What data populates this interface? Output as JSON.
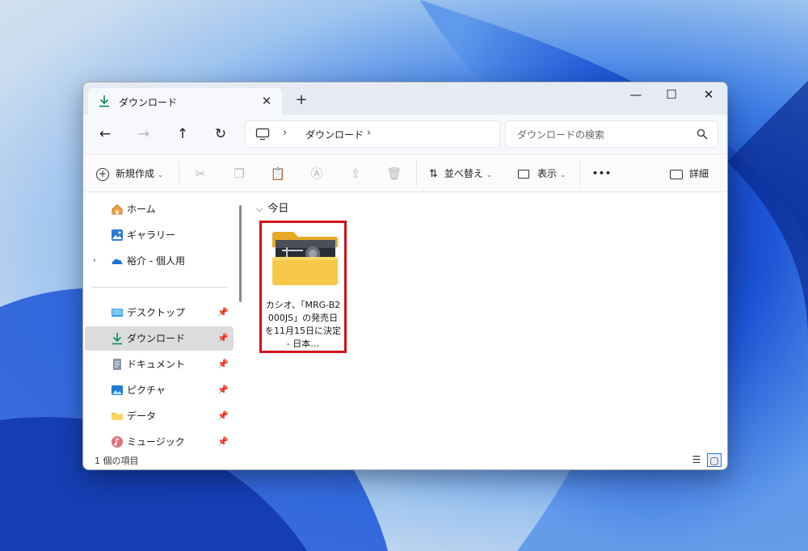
{
  "window": {
    "tab_title": "ダウンロード",
    "tab_close": "✕",
    "new_tab": "+",
    "minimize": "—",
    "maximize": "☐",
    "close": "✕"
  },
  "nav": {
    "back": "←",
    "forward": "→",
    "up": "↑",
    "refresh": "↻",
    "breadcrumb_sep": "›",
    "breadcrumb_item": "ダウンロード",
    "search_placeholder": "ダウンロードの検索"
  },
  "toolbar": {
    "new_label": "新規作成",
    "sort_label": "並べ替え",
    "view_label": "表示",
    "more_label": "•••",
    "details_label": "詳細"
  },
  "sidebar": {
    "items": [
      {
        "label": "ホーム",
        "icon": "home-icon"
      },
      {
        "label": "ギャラリー",
        "icon": "gallery-icon"
      },
      {
        "label": "裕介 - 個人用",
        "icon": "onedrive-icon"
      },
      {
        "label": "デスクトップ",
        "icon": "desktop-icon"
      },
      {
        "label": "ダウンロード",
        "icon": "download-icon"
      },
      {
        "label": "ドキュメント",
        "icon": "document-icon"
      },
      {
        "label": "ピクチャ",
        "icon": "pictures-icon"
      },
      {
        "label": "データ",
        "icon": "folder-icon"
      },
      {
        "label": "ミュージック",
        "icon": "music-icon"
      }
    ]
  },
  "content": {
    "group_header": "今日",
    "file": {
      "name": "カシオ、「MRG-B2000JS」の発売日を11月15日に決定 - 日本…"
    }
  },
  "status": {
    "item_count": "1 個の項目"
  },
  "colors": {
    "accent": "#0a8a3a",
    "highlight_border": "#d0111b",
    "folder_yellow": "#f5c242"
  }
}
